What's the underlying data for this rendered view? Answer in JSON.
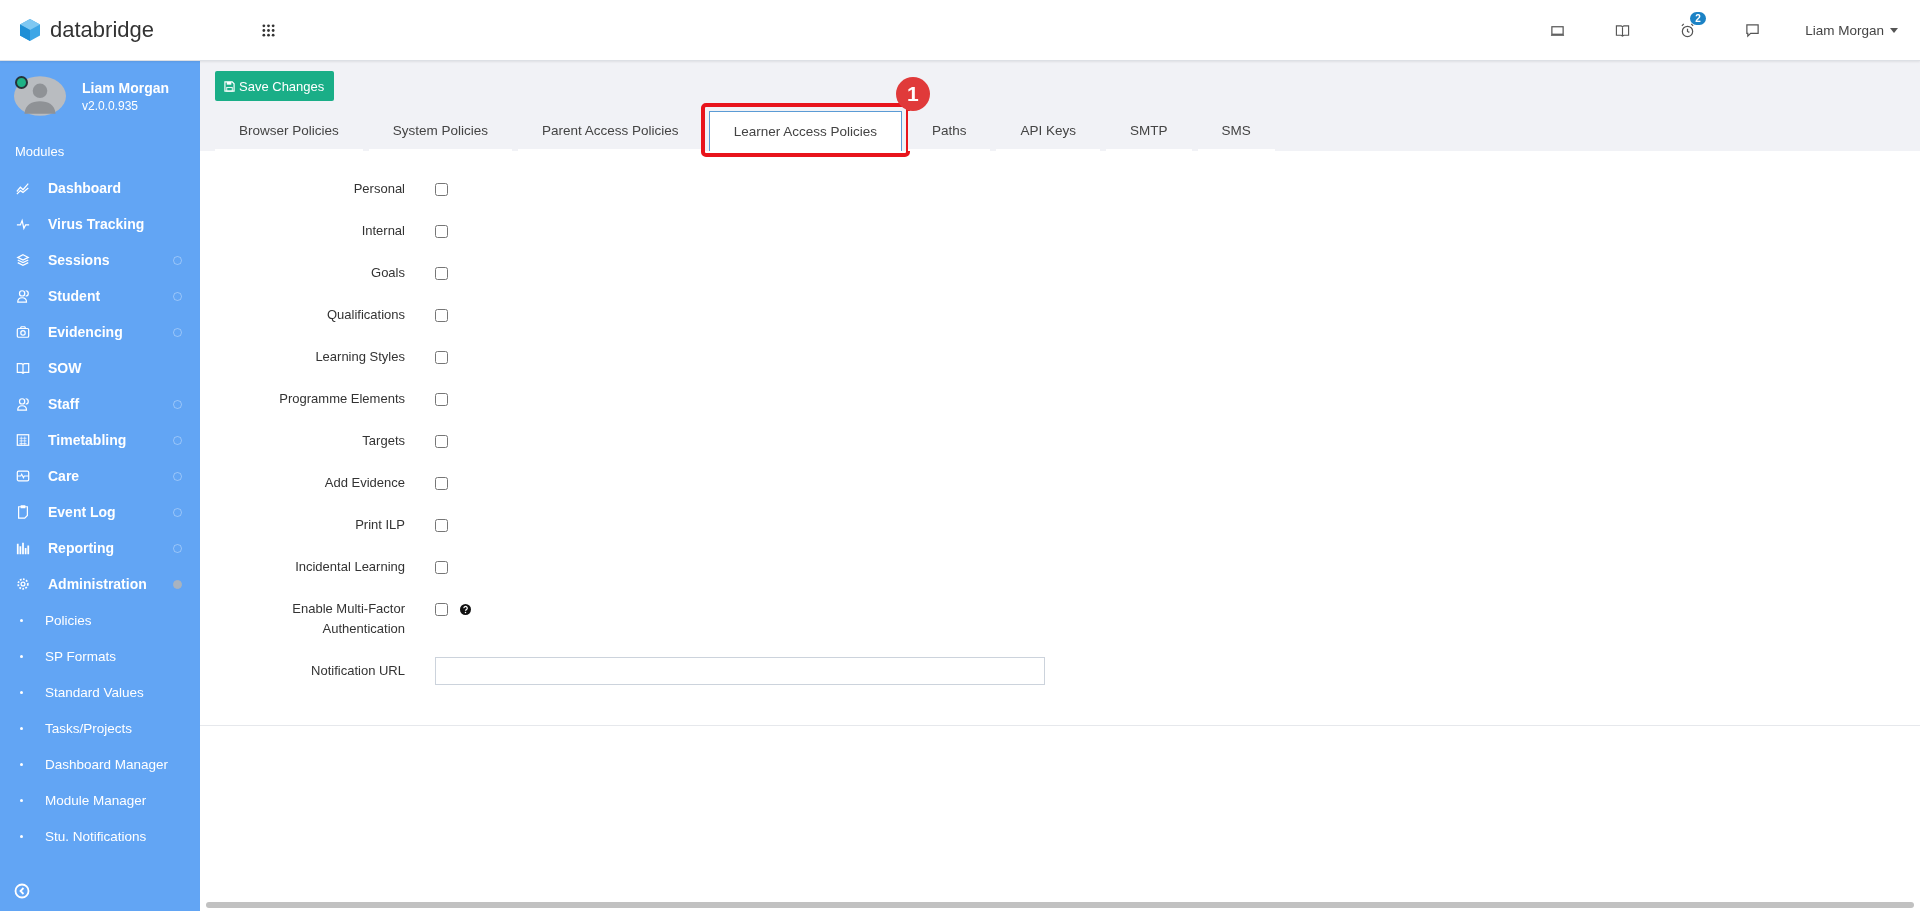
{
  "header": {
    "brand": "databridge",
    "user": "Liam Morgan",
    "alerts_badge": "2"
  },
  "sidebar": {
    "profile": {
      "name": "Liam Morgan",
      "version": "v2.0.0.935",
      "online": true
    },
    "section": "Modules",
    "items": [
      {
        "label": "Dashboard",
        "kind": "link"
      },
      {
        "label": "Virus Tracking",
        "kind": "link"
      },
      {
        "label": "Sessions",
        "kind": "group",
        "expanded": false
      },
      {
        "label": "Student",
        "kind": "group",
        "expanded": false
      },
      {
        "label": "Evidencing",
        "kind": "group",
        "expanded": false
      },
      {
        "label": "SOW",
        "kind": "link"
      },
      {
        "label": "Staff",
        "kind": "group",
        "expanded": false
      },
      {
        "label": "Timetabling",
        "kind": "group",
        "expanded": false
      },
      {
        "label": "Care",
        "kind": "group",
        "expanded": false
      },
      {
        "label": "Event Log",
        "kind": "group",
        "expanded": false
      },
      {
        "label": "Reporting",
        "kind": "group",
        "expanded": false
      },
      {
        "label": "Administration",
        "kind": "group",
        "expanded": true,
        "children": [
          {
            "label": "Policies"
          },
          {
            "label": "SP Formats"
          },
          {
            "label": "Standard Values"
          },
          {
            "label": "Tasks/Projects"
          },
          {
            "label": "Dashboard Manager"
          },
          {
            "label": "Module Manager"
          },
          {
            "label": "Stu. Notifications"
          }
        ]
      }
    ]
  },
  "save_button": "Save Changes",
  "tabs": [
    {
      "label": "Browser Policies",
      "selected": false
    },
    {
      "label": "System Policies",
      "selected": false
    },
    {
      "label": "Parent Access Policies",
      "selected": false
    },
    {
      "label": "Learner Access Policies",
      "selected": true,
      "callout": "1"
    },
    {
      "label": "Paths",
      "selected": false
    },
    {
      "label": "API Keys",
      "selected": false
    },
    {
      "label": "SMTP",
      "selected": false
    },
    {
      "label": "SMS",
      "selected": false
    }
  ],
  "form": [
    {
      "kind": "checkbox",
      "label": "Personal",
      "checked": false
    },
    {
      "kind": "checkbox",
      "label": "Internal",
      "checked": false
    },
    {
      "kind": "checkbox",
      "label": "Goals",
      "checked": false
    },
    {
      "kind": "checkbox",
      "label": "Qualifications",
      "checked": false
    },
    {
      "kind": "checkbox",
      "label": "Learning Styles",
      "checked": false
    },
    {
      "kind": "checkbox",
      "label": "Programme Elements",
      "checked": false
    },
    {
      "kind": "checkbox",
      "label": "Targets",
      "checked": false
    },
    {
      "kind": "checkbox",
      "label": "Add Evidence",
      "checked": false
    },
    {
      "kind": "checkbox",
      "label": "Print ILP",
      "checked": false
    },
    {
      "kind": "checkbox",
      "label": "Incidental Learning",
      "checked": false
    },
    {
      "kind": "checkbox",
      "label": "Enable Multi-Factor Authentication",
      "checked": false,
      "help": true
    },
    {
      "kind": "text",
      "label": "Notification URL"
    }
  ]
}
